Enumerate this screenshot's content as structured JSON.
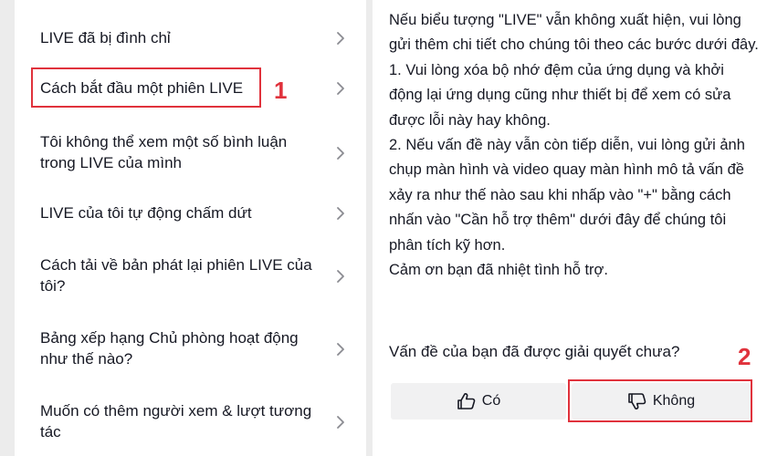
{
  "help_list": {
    "items": [
      {
        "label": "LIVE đã bị đình chỉ"
      },
      {
        "label": "Cách bắt đầu một phiên LIVE"
      },
      {
        "label": "Tôi không thể xem một số bình luận trong LIVE của mình"
      },
      {
        "label": "LIVE của tôi tự động chấm dứt"
      },
      {
        "label": "Cách tải về bản phát lại phiên LIVE của tôi?"
      },
      {
        "label": "Bảng xếp hạng Chủ phòng hoạt động như thế nào?"
      },
      {
        "label": "Muốn có thêm người xem & lượt tương tác"
      }
    ]
  },
  "annotations": {
    "step1": "1",
    "step2": "2",
    "color": "#e0323c"
  },
  "article": {
    "paragraphs": [
      "Nếu biểu tượng \"LIVE\" vẫn không xuất hiện, vui lòng gửi thêm chi tiết cho chúng tôi theo các bước dưới đây.",
      "1. Vui lòng xóa bộ nhớ đệm của ứng dụng và khởi động lại ứng dụng cũng như thiết bị để xem có sửa được lỗi này hay không.",
      "2. Nếu vấn đề này vẫn còn tiếp diễn, vui lòng gửi ảnh chụp màn hình và video quay màn hình mô tả vấn đề xảy ra như thế nào sau khi nhấp vào \"+\" bằng cách nhấn vào \"Cần hỗ trợ thêm\" dưới đây để chúng tôi phân tích kỹ hơn.",
      "Cảm ơn bạn đã nhiệt tình hỗ trợ."
    ]
  },
  "feedback": {
    "question": "Vấn đề của bạn đã được giải quyết chưa?",
    "yes_label": "Có",
    "no_label": "Không",
    "yes_icon": "thumbs-up-icon",
    "no_icon": "thumbs-down-icon"
  }
}
